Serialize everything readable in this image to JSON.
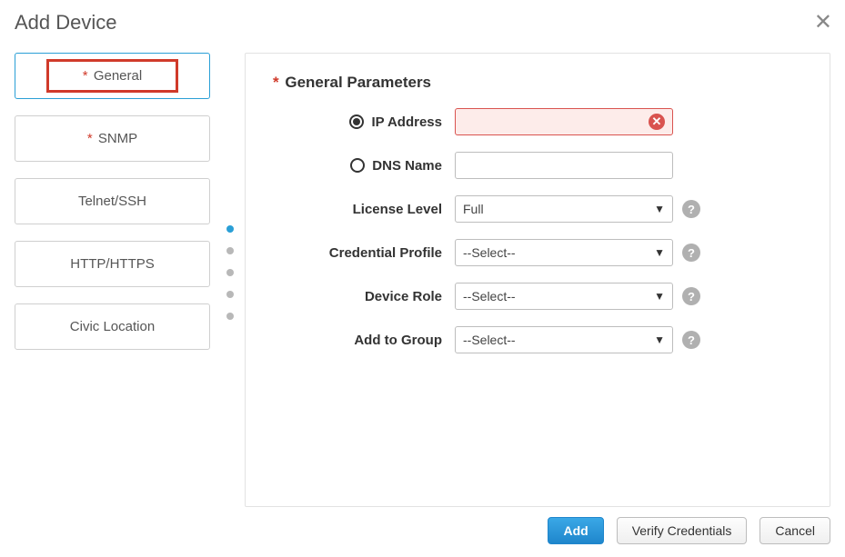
{
  "dialog": {
    "title": "Add Device"
  },
  "sidebar": {
    "tabs": [
      {
        "label": "General",
        "required": true
      },
      {
        "label": "SNMP",
        "required": true
      },
      {
        "label": "Telnet/SSH",
        "required": false
      },
      {
        "label": "HTTP/HTTPS",
        "required": false
      },
      {
        "label": "Civic Location",
        "required": false
      }
    ]
  },
  "section_title": "General Parameters",
  "fields": {
    "ip_address": {
      "label": "IP Address",
      "value": ""
    },
    "dns_name": {
      "label": "DNS Name",
      "value": ""
    },
    "license_level": {
      "label": "License Level",
      "value": "Full"
    },
    "credential_profile": {
      "label": "Credential Profile",
      "value": "--Select--"
    },
    "device_role": {
      "label": "Device Role",
      "value": "--Select--"
    },
    "add_to_group": {
      "label": "Add to Group",
      "value": "--Select--"
    }
  },
  "buttons": {
    "add": "Add",
    "verify": "Verify Credentials",
    "cancel": "Cancel"
  }
}
